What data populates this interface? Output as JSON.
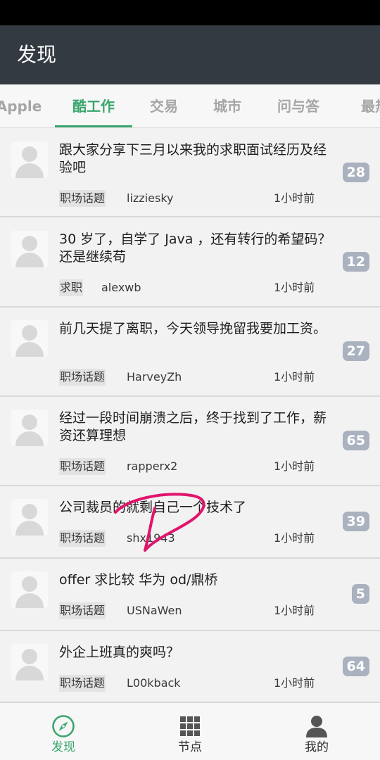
{
  "app": {
    "title": "发现"
  },
  "tabs": [
    {
      "label": "Apple",
      "active": false
    },
    {
      "label": "酷工作",
      "active": true
    },
    {
      "label": "交易",
      "active": false
    },
    {
      "label": "城市",
      "active": false
    },
    {
      "label": "问与答",
      "active": false
    },
    {
      "label": "最热",
      "active": false
    }
  ],
  "topics": [
    {
      "title": "跟大家分享下三月以来我的求职面试经历及经验吧",
      "node": "职场话题",
      "author": "lizziesky",
      "time": "1小时前",
      "replies": "28"
    },
    {
      "title": "30 岁了，自学了 Java ，还有转行的希望码？还是继续苟",
      "node": "求职",
      "author": "alexwb",
      "time": "1小时前",
      "replies": "12"
    },
    {
      "title": "前几天提了离职，今天领导挽留我要加工资。",
      "node": "职场话题",
      "author": "HarveyZh",
      "time": "1小时前",
      "replies": "27"
    },
    {
      "title": "经过一段时间崩溃之后，终于找到了工作，薪资还算理想",
      "node": "职场话题",
      "author": "rapperx2",
      "time": "1小时前",
      "replies": "65"
    },
    {
      "title": "公司裁员的就剩自己一个技术了",
      "node": "职场话题",
      "author": "shx1943",
      "time": "1小时前",
      "replies": "39"
    },
    {
      "title": "offer 求比较 华为 od/鼎桥",
      "node": "职场话题",
      "author": "USNaWen",
      "time": "1小时前",
      "replies": "5"
    },
    {
      "title": "外企上班真的爽吗？",
      "node": "职场话题",
      "author": "L00kback",
      "time": "1小时前",
      "replies": "64"
    }
  ],
  "bottom_nav": [
    {
      "label": "发现",
      "icon": "compass-icon",
      "active": true
    },
    {
      "label": "节点",
      "icon": "grid-icon",
      "active": false
    },
    {
      "label": "我的",
      "icon": "person-icon",
      "active": false
    }
  ],
  "colors": {
    "accent": "#3aa66e",
    "app_bar": "#333a42",
    "badge": "#aab2bf",
    "annotation": "#e0156c"
  }
}
